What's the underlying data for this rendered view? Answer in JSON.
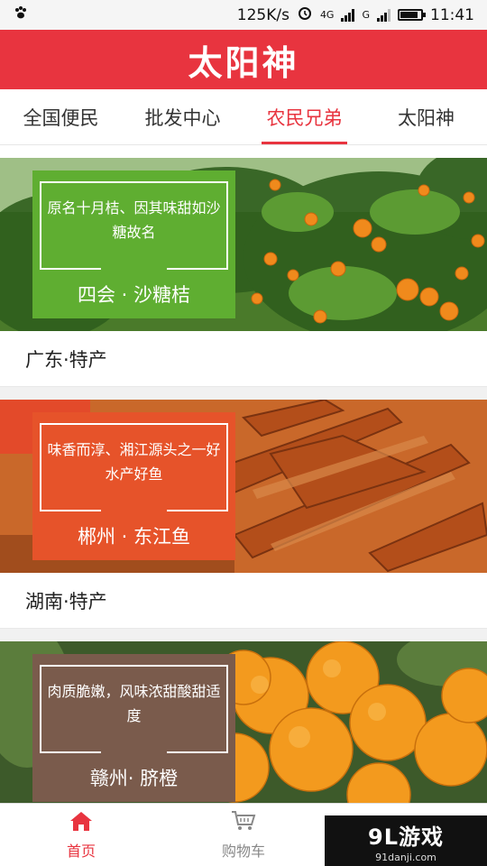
{
  "status_bar": {
    "net_speed": "125K/s",
    "network_type": "4G",
    "carrier_mark": "G",
    "time": "11:41",
    "battery_level": 0.85,
    "icons": [
      "paw-notification-icon",
      "alarm-clock-icon",
      "signal-icon",
      "battery-icon"
    ]
  },
  "header": {
    "title": "太阳神",
    "bg_color": "#e8343f"
  },
  "tabs": [
    {
      "label": "全国便民",
      "active": false
    },
    {
      "label": "批发中心",
      "active": false
    },
    {
      "label": "农民兄弟",
      "active": true
    },
    {
      "label": "太阳神",
      "active": false
    }
  ],
  "products": [
    {
      "slogan": "原名十月桔、因其味甜如沙糖故名",
      "name": "四会 · 沙糖桔",
      "region": "广东·特产",
      "overlay_color": "#5fae31"
    },
    {
      "slogan": "味香而淳、湘江源头之一好水产好鱼",
      "name": "郴州 · 东江鱼",
      "region": "湖南·特产",
      "overlay_color": "#e6532a"
    },
    {
      "slogan": "肉质脆嫩，风味浓甜酸甜适度",
      "name": "赣州· 脐橙",
      "region": "",
      "overlay_color": "#7a5b4c"
    }
  ],
  "bottom_nav": [
    {
      "label": "首页",
      "icon": "home-icon",
      "active": true
    },
    {
      "label": "购物车",
      "icon": "cart-icon",
      "active": false
    }
  ],
  "watermark": {
    "logo": "9L游戏",
    "url": "91danji.com"
  }
}
